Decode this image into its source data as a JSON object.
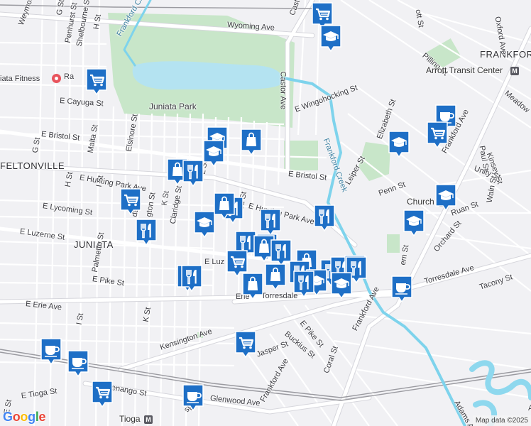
{
  "map": {
    "colors": {
      "land": "#f1f1f4",
      "road": "#ffffff",
      "road_casing": "#d6d6dc",
      "park": "#c8e6c9",
      "water": "#8ed8ee",
      "creek": "#7ed3ec",
      "pin": "#1e6fc6",
      "rail": "#9a9aa0"
    },
    "labels": [
      {
        "name": "label-frankford",
        "text": "FRANKFORD",
        "cls": "big"
      },
      {
        "name": "label-feltonville",
        "text": "FELTONVILLE",
        "cls": "big"
      },
      {
        "name": "label-juniata",
        "text": "JUNIATA",
        "cls": "big"
      },
      {
        "name": "label-juniata-park",
        "text": "Juniata Park",
        "cls": "park"
      },
      {
        "name": "label-frankford-creek-1",
        "text": "Frankford Creek",
        "cls": "creek"
      },
      {
        "name": "label-frankford-creek-2",
        "text": "Frankford Creek",
        "cls": "creek"
      },
      {
        "name": "label-wyoming-ave",
        "text": "Wyoming Ave"
      },
      {
        "name": "label-castor-ave",
        "text": "Castor Ave"
      },
      {
        "name": "label-castor-top",
        "text": "Castor"
      },
      {
        "name": "label-e-cayuga-st",
        "text": "E Cayuga St"
      },
      {
        "name": "label-e-bristol-st-w",
        "text": "E Bristol St"
      },
      {
        "name": "label-e-bristol-st-e",
        "text": "E Bristol St"
      },
      {
        "name": "label-e-hunting-park-ave-w",
        "text": "E Hunting Park Ave"
      },
      {
        "name": "label-e-hunting-park-ave-e",
        "text": "E Hunting Park Ave"
      },
      {
        "name": "label-e-lycoming-st",
        "text": "E Lycoming St"
      },
      {
        "name": "label-e-luzerne-st",
        "text": "E Luzerne St"
      },
      {
        "name": "label-e-luz",
        "text": "E Luz"
      },
      {
        "name": "label-e-pike-st-w",
        "text": "E Pike St"
      },
      {
        "name": "label-e-pike-st-e",
        "text": "E Pike St"
      },
      {
        "name": "label-e-erie-ave-w",
        "text": "E Erie Ave"
      },
      {
        "name": "label-e-erie-ave-mid",
        "text": "Erie"
      },
      {
        "name": "label-torresdale-ave-mid",
        "text": "Torresdale"
      },
      {
        "name": "label-torresdale-ave",
        "text": "Torresdale Ave"
      },
      {
        "name": "label-tacony-st",
        "text": "Tacony St"
      },
      {
        "name": "label-e-wingohocking-st",
        "text": "E Wingohocking St"
      },
      {
        "name": "label-pilling-st",
        "text": "Pilling St"
      },
      {
        "name": "label-arrott-transit",
        "text": "Arrott Transit Center",
        "cls": "transit"
      },
      {
        "name": "label-meadow",
        "text": "Meadow"
      },
      {
        "name": "label-elizabeth-st",
        "text": "Elizabeth St"
      },
      {
        "name": "label-frankford-ave-n",
        "text": "Frankford Ave"
      },
      {
        "name": "label-frankford-ave-s",
        "text": "Frankford Ave"
      },
      {
        "name": "label-oxford-ave",
        "text": "Oxford Ave"
      },
      {
        "name": "label-paul-st",
        "text": "Paul St"
      },
      {
        "name": "label-kinsey-st",
        "text": "Kinsey St"
      },
      {
        "name": "label-unity-st",
        "text": "Unity St"
      },
      {
        "name": "label-leiper-st",
        "text": "Leiper St"
      },
      {
        "name": "label-penn-st",
        "text": "Penn St"
      },
      {
        "name": "label-church",
        "text": "Church",
        "cls": "transit"
      },
      {
        "name": "label-ruan-st",
        "text": "Ruan St"
      },
      {
        "name": "label-waln-st",
        "text": "Waln St"
      },
      {
        "name": "label-orchard-st",
        "text": "Orchard St"
      },
      {
        "name": "label-em-st",
        "text": "em St"
      },
      {
        "name": "label-buckius-st",
        "text": "Buckius St"
      },
      {
        "name": "label-coral-st",
        "text": "Coral St"
      },
      {
        "name": "label-jasper-st-e",
        "text": "Jasper St"
      },
      {
        "name": "label-jasper-st-s",
        "text": "sper St"
      },
      {
        "name": "label-kensington-ave",
        "text": "Kensington Ave"
      },
      {
        "name": "label-frankford-ave-bottom",
        "text": "Frankford Ave"
      },
      {
        "name": "label-e-venango-st",
        "text": "E Venango St"
      },
      {
        "name": "label-glenwood-ave",
        "text": "Glenwood Ave"
      },
      {
        "name": "label-e-tioga-st",
        "text": "E Tioga St"
      },
      {
        "name": "label-tioga",
        "text": "Tioga",
        "cls": "transit"
      },
      {
        "name": "label-adams-ave",
        "text": "Adams Ave"
      },
      {
        "name": "label-weymouth-st",
        "text": "Weymouth St"
      },
      {
        "name": "label-g-st-top",
        "text": "G St"
      },
      {
        "name": "label-g-st",
        "text": "G St"
      },
      {
        "name": "label-h-st-top",
        "text": "H St"
      },
      {
        "name": "label-h-st",
        "text": "H St"
      },
      {
        "name": "label-i-st",
        "text": "I St"
      },
      {
        "name": "label-i-st-s",
        "text": "I St"
      },
      {
        "name": "label-e-st",
        "text": "E St"
      },
      {
        "name": "label-k-st",
        "text": "K St"
      },
      {
        "name": "label-k-st-s",
        "text": "K St"
      },
      {
        "name": "label-l-st",
        "text": "L St"
      },
      {
        "name": "label-penhurst-st",
        "text": "Penhurst St"
      },
      {
        "name": "label-shelbourne-st",
        "text": "Shelbourne St"
      },
      {
        "name": "label-malta-st",
        "text": "Malta St"
      },
      {
        "name": "label-elsinore-st",
        "text": "Elsinore St"
      },
      {
        "name": "label-claridge-st",
        "text": "Claridge St"
      },
      {
        "name": "label-palmetto-st",
        "text": "Palmetto St"
      },
      {
        "name": "label-dale-st",
        "text": "dale St"
      },
      {
        "name": "label-gton-st",
        "text": "gton St"
      },
      {
        "name": "label-od-st",
        "text": "od St"
      },
      {
        "name": "label-ott-st",
        "text": "ott St"
      },
      {
        "name": "label-ra",
        "text": "Ra"
      },
      {
        "name": "label-juniata-fitness",
        "text": "iata Fitness"
      },
      {
        "name": "label-arr",
        "text": "Arr"
      }
    ],
    "pins": [
      {
        "name": "grocery-store-pin",
        "icon": "cart-icon"
      },
      {
        "name": "school-pin",
        "icon": "graduation-cap-icon"
      },
      {
        "name": "grocery-store-pin",
        "icon": "cart-icon"
      },
      {
        "name": "school-pin",
        "icon": "graduation-cap-icon"
      },
      {
        "name": "school-pin",
        "icon": "graduation-cap-icon"
      },
      {
        "name": "shopping-pin",
        "icon": "shopping-bag-icon"
      },
      {
        "name": "shopping-pin",
        "icon": "shopping-bag-icon"
      },
      {
        "name": "restaurant-pin",
        "icon": "fork-knife-icon"
      },
      {
        "name": "grocery-store-pin",
        "icon": "cart-icon"
      },
      {
        "name": "restaurant-pin",
        "icon": "fork-knife-icon"
      },
      {
        "name": "school-pin",
        "icon": "graduation-cap-icon"
      },
      {
        "name": "shopping-pin",
        "icon": "shopping-bag-icon"
      },
      {
        "name": "restaurant-pin",
        "icon": "fork-knife-icon"
      },
      {
        "name": "restaurant-pin",
        "icon": "fork-knife-icon"
      },
      {
        "name": "restaurant-pin",
        "icon": "fork-knife-icon"
      },
      {
        "name": "restaurant-pin",
        "icon": "fork-knife-icon"
      },
      {
        "name": "restaurant-pin",
        "icon": "fork-knife-icon"
      },
      {
        "name": "grocery-store-pin",
        "icon": "cart-icon"
      },
      {
        "name": "shopping-pin",
        "icon": "shopping-bag-icon"
      },
      {
        "name": "restaurant-pin",
        "icon": "fork-knife-icon"
      },
      {
        "name": "grocery-store-pin",
        "icon": "cart-icon"
      },
      {
        "name": "shopping-pin",
        "icon": "shopping-bag-icon"
      },
      {
        "name": "restaurant-pin",
        "icon": "fork-knife-icon"
      },
      {
        "name": "shopping-pin",
        "icon": "shopping-bag-icon"
      },
      {
        "name": "restaurant-pin",
        "icon": "fork-knife-icon"
      },
      {
        "name": "school-pin",
        "icon": "graduation-cap-icon"
      },
      {
        "name": "restaurant-pin",
        "icon": "fork-knife-icon"
      },
      {
        "name": "restaurant-pin",
        "icon": "fork-knife-icon"
      },
      {
        "name": "school-pin",
        "icon": "graduation-cap-icon"
      },
      {
        "name": "shopping-pin",
        "icon": "shopping-bag-icon"
      },
      {
        "name": "restaurant-pin",
        "icon": "fork-knife-icon"
      },
      {
        "name": "school-pin",
        "icon": "graduation-cap-icon"
      },
      {
        "name": "restaurant-pin",
        "icon": "fork-knife-icon"
      },
      {
        "name": "cafe-pin",
        "icon": "coffee-cup-icon"
      },
      {
        "name": "grocery-store-pin",
        "icon": "cart-icon"
      },
      {
        "name": "school-pin",
        "icon": "graduation-cap-icon"
      },
      {
        "name": "school-pin",
        "icon": "graduation-cap-icon"
      },
      {
        "name": "school-pin",
        "icon": "graduation-cap-icon"
      },
      {
        "name": "cafe-pin",
        "icon": "coffee-cup-icon"
      },
      {
        "name": "grocery-store-pin",
        "icon": "cart-icon"
      },
      {
        "name": "cafe-pin",
        "icon": "coffee-cup-icon"
      },
      {
        "name": "cafe-pin",
        "icon": "coffee-cup-icon"
      },
      {
        "name": "grocery-store-pin",
        "icon": "cart-icon"
      },
      {
        "name": "cafe-pin",
        "icon": "coffee-cup-icon"
      }
    ],
    "google_logo": "Google",
    "attribution": "Map data ©2025"
  }
}
